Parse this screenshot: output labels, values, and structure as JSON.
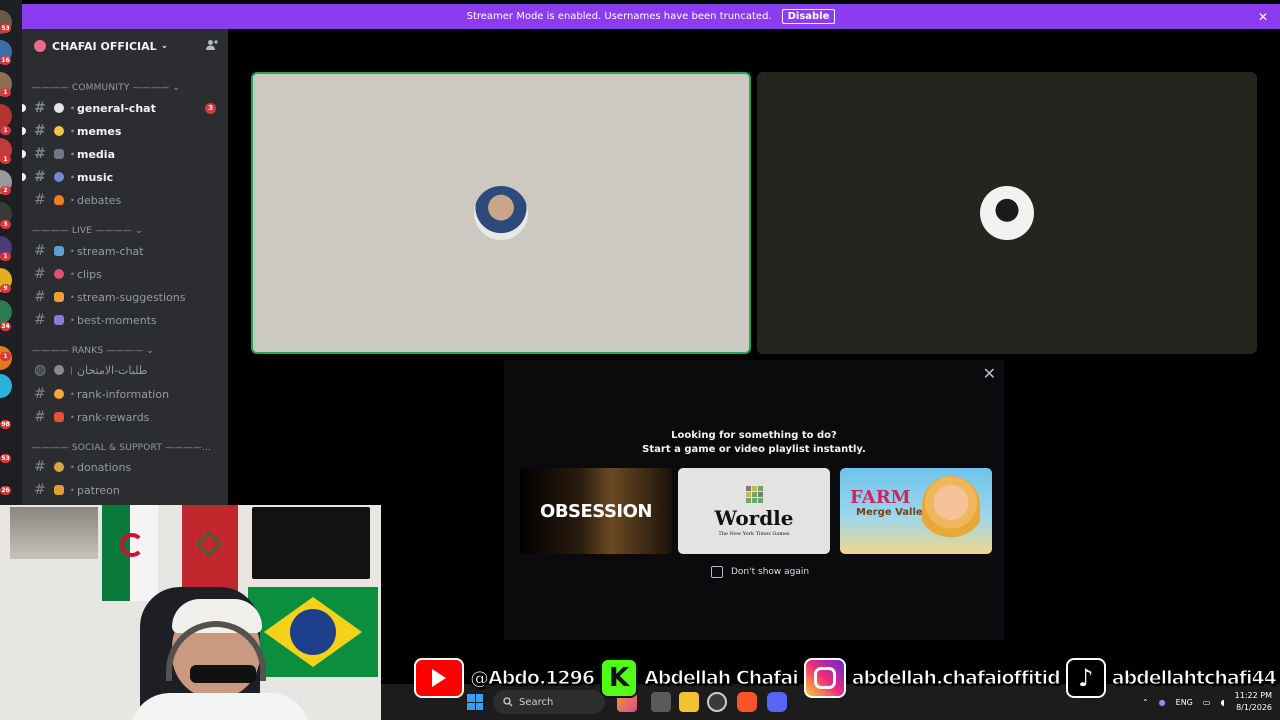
{
  "banner": {
    "message": "Streamer Mode is enabled. Usernames have been truncated.",
    "button": "Disable",
    "close": "✕"
  },
  "server": {
    "name": "CHAFAI OFFICIAL",
    "chevron": "⌄",
    "invite_icon": "person-add-icon"
  },
  "rail_badges": [
    "53",
    "16",
    "1",
    "1",
    "1",
    "2",
    "3",
    "1",
    "9",
    "24",
    "1",
    "98",
    "53",
    "26"
  ],
  "categories": {
    "community": "———— COMMUNITY ———— ⌄",
    "live": "———— LIVE ———— ⌄",
    "ranks": "———— RANKS ———— ⌄",
    "social": "———— SOCIAL & SUPPORT ————..."
  },
  "channels": [
    {
      "name": "general-chat",
      "unread": true,
      "badge": "3",
      "emoji_color": "#e3e5e8"
    },
    {
      "name": "memes",
      "unread": true,
      "badge": "",
      "emoji_color": "#f5c542"
    },
    {
      "name": "media",
      "unread": true,
      "badge": "",
      "emoji_color": "#6d7a8a"
    },
    {
      "name": "music",
      "unread": true,
      "badge": "",
      "emoji_color": "#7289da"
    },
    {
      "name": "debates",
      "unread": false,
      "badge": "",
      "emoji_color": "#f47b20"
    },
    {
      "name": "stream-chat",
      "unread": false,
      "badge": "",
      "emoji_color": "#5aa0d8"
    },
    {
      "name": "clips",
      "unread": false,
      "badge": "",
      "emoji_color": "#e0506e"
    },
    {
      "name": "stream-suggestions",
      "unread": false,
      "badge": "",
      "emoji_color": "#f0a030"
    },
    {
      "name": "best-moments",
      "unread": false,
      "badge": "",
      "emoji_color": "#8f7ad8"
    },
    {
      "name": "طلبات-الامتحان",
      "unread": false,
      "badge": "",
      "emoji_color": "#8a8a8a"
    },
    {
      "name": "rank-information",
      "unread": false,
      "badge": "",
      "emoji_color": "#f2a93b"
    },
    {
      "name": "rank-rewards",
      "unread": false,
      "badge": "",
      "emoji_color": "#e8503a"
    },
    {
      "name": "donations",
      "unread": false,
      "badge": "",
      "emoji_color": "#d9a441"
    },
    {
      "name": "patreon",
      "unread": false,
      "badge": "",
      "emoji_color": "#e0a030"
    }
  ],
  "popup": {
    "close": "✕",
    "line1": "Looking for something to do?",
    "line2": "Start a game or video playlist instantly.",
    "games": [
      {
        "title": "OBSESSION"
      },
      {
        "title": "Wordle",
        "subtitle": "The New York Times Games"
      },
      {
        "title": "FARM",
        "subtitle": "Merge Valley"
      }
    ],
    "dont_show": "Don't show again"
  },
  "socials": {
    "youtube": "@Abdo.1296",
    "kick_letter": "K",
    "kick": "Abdellah Chafai",
    "instagram": "abdellah.chafaioffitid",
    "tiktok": "abdellahtchafi44"
  },
  "taskbar": {
    "search": "Search",
    "language": "ENG",
    "time": "11:22 PM",
    "date": "8/1/2026",
    "tray_up": "⌃",
    "search_icon": "magnifier-icon"
  },
  "colors": {
    "banner": "#8c3cf0",
    "speaking_border": "#23a55a",
    "badge": "#da373c"
  }
}
